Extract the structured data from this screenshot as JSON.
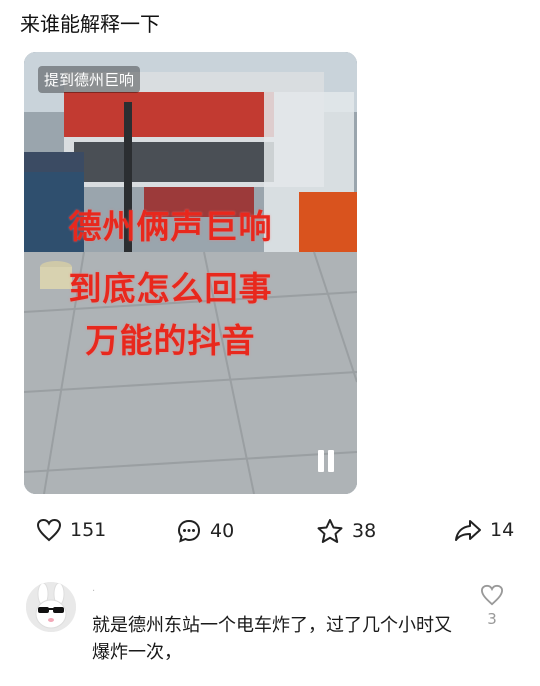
{
  "post": {
    "title": "来谁能解释一下"
  },
  "video": {
    "tag": "提到德州巨响",
    "overlay_lines": [
      "德州俩声巨响",
      "到底怎么回事",
      "万能的抖音"
    ],
    "overlay_color": "#e8281d",
    "state": "playing"
  },
  "actions": {
    "like_count": "151",
    "comment_count": "40",
    "favorite_count": "38",
    "share_count": "14"
  },
  "comment": {
    "mark": "·",
    "text": "就是德州东站一个电车炸了，过了几个小时又爆炸一次，",
    "like_count": "3"
  }
}
